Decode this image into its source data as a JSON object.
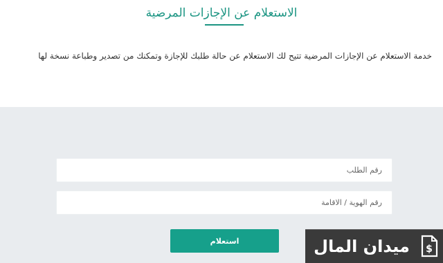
{
  "header": {
    "title": "الاستعلام عن الإجازات المرضية",
    "description": "خدمة الاستعلام عن الإجازات المرضية تتيح لك الاستعلام عن حالة طلبك للإجازة وتمكنك من تصدير وطباعة نسخة لها"
  },
  "form": {
    "request_number_placeholder": "رقم الطلب",
    "request_number_value": "",
    "id_placeholder": "رقم الهوية / الاقامة",
    "id_value": "",
    "submit_label": "استعلام"
  },
  "watermark": {
    "text": "ميدان المال",
    "logo_icon": "money-doc-icon"
  },
  "colors": {
    "accent": "#1a9482",
    "button": "#16a08b",
    "form_background": "#e9ecef"
  }
}
